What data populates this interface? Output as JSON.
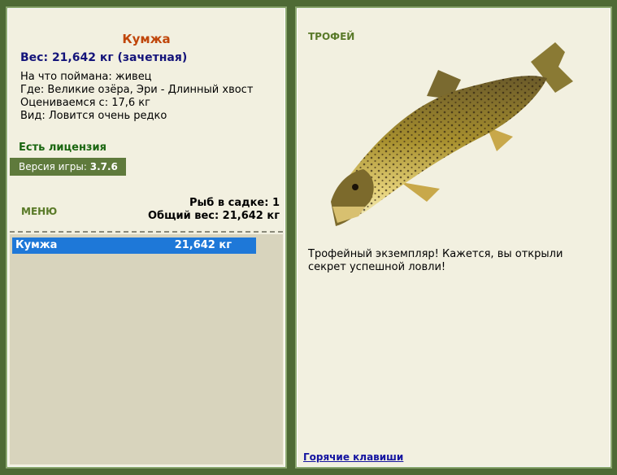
{
  "catch": {
    "name": "Кумжа",
    "weight": "Вес: 21,642 кг (зачетная)",
    "bait": "На что поймана: живец",
    "location": "Где: Великие озёра, Эри - Длинный хвост",
    "threshold": "Оцениваемся с: 17,6 кг",
    "rarity": "Вид: Ловится очень редко"
  },
  "license": "Есть лицензия",
  "version": {
    "label": "Версия игры:",
    "value": "3.7.6"
  },
  "menu_label": "МЕНЮ",
  "cage": {
    "count": "Рыб в садке: 1",
    "total": "Общий вес: 21,642 кг"
  },
  "list": [
    {
      "name": "Кумжа",
      "weight": "21,642 кг"
    }
  ],
  "trophy": {
    "label": "ТРОФЕЙ",
    "description": "Трофейный экземпляр! Кажется, вы открыли секрет успешной ловли!",
    "image_icon": "brown-trout-image"
  },
  "hotkeys_link": "Горячие клавиши",
  "colors": {
    "background": "#4e6a35",
    "panel": "#f2f0e0",
    "accent_title": "#c0460a",
    "selection": "#1e78d8"
  }
}
